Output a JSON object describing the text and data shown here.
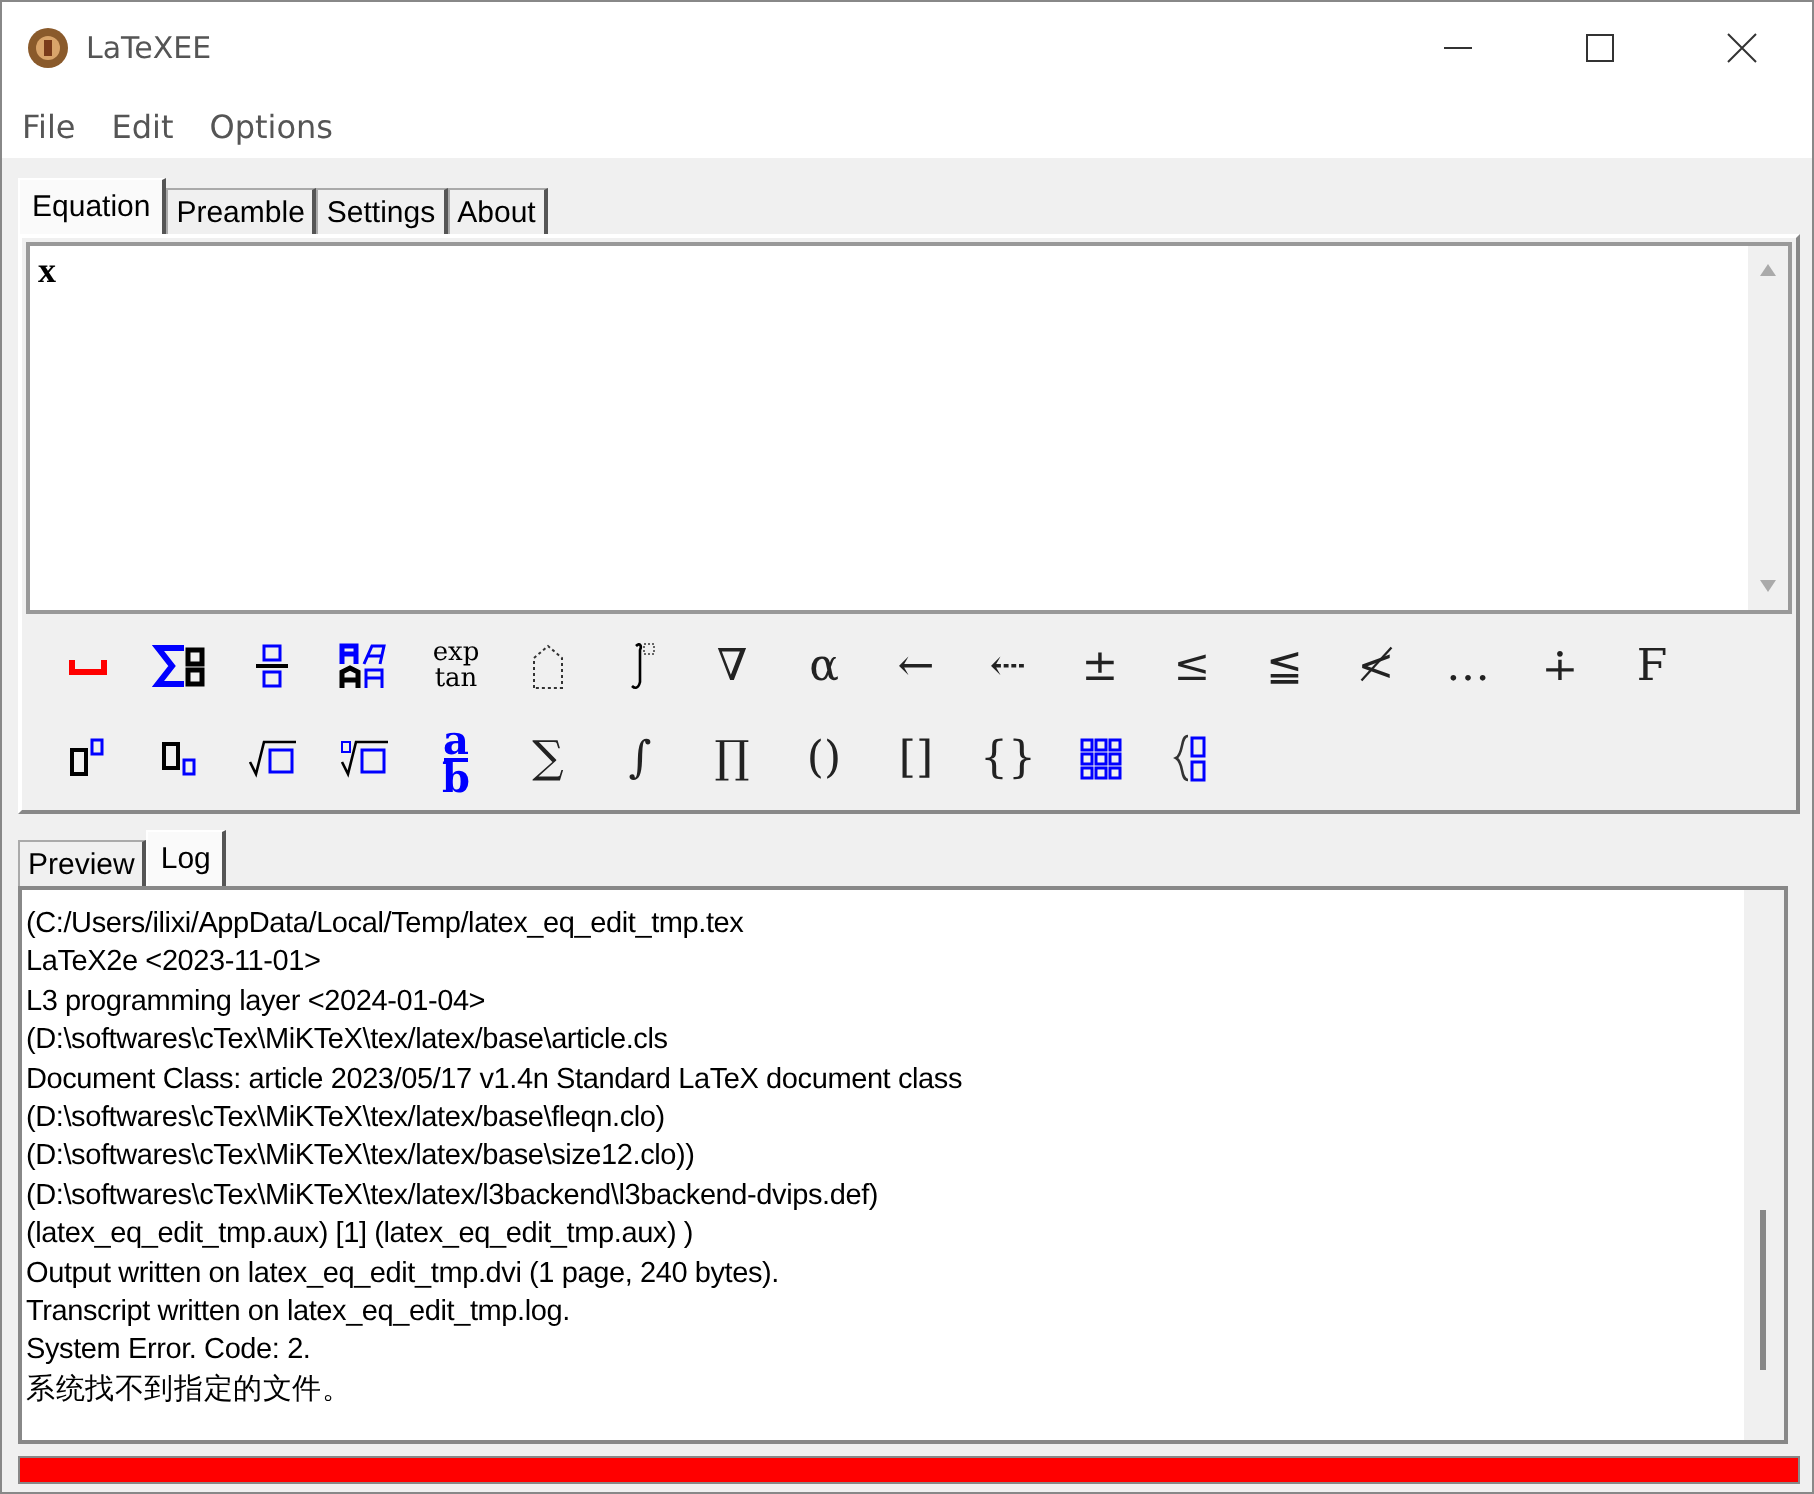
{
  "window": {
    "title": "LaTeXEE"
  },
  "menu": [
    "File",
    "Edit",
    "Options"
  ],
  "tabs": [
    {
      "label": "Equation",
      "selected": true
    },
    {
      "label": "Preamble",
      "selected": false
    },
    {
      "label": "Settings",
      "selected": false
    },
    {
      "label": "About",
      "selected": false
    }
  ],
  "equation": {
    "value": "x"
  },
  "toolbar_rows": [
    [
      {
        "kind": "space"
      },
      {
        "kind": "sum-boxes"
      },
      {
        "kind": "fraction-boxes"
      },
      {
        "kind": "font-styles"
      },
      {
        "kind": "functions",
        "lines": [
          "exp",
          "tan"
        ]
      },
      {
        "kind": "dotted-box"
      },
      {
        "kind": "integral-boxes"
      },
      {
        "kind": "glyph",
        "symbol": "∇"
      },
      {
        "kind": "glyph",
        "symbol": "α"
      },
      {
        "kind": "glyph",
        "symbol": "←"
      },
      {
        "kind": "glyph",
        "symbol": "⇠"
      },
      {
        "kind": "glyph",
        "symbol": "±"
      },
      {
        "kind": "glyph",
        "symbol": "≤"
      },
      {
        "kind": "glyph",
        "symbol": "≦"
      },
      {
        "kind": "glyph",
        "symbol": "≮"
      },
      {
        "kind": "glyph",
        "symbol": "…"
      },
      {
        "kind": "glyph",
        "symbol": "∔"
      },
      {
        "kind": "glyph",
        "symbol": "Ϝ"
      }
    ],
    [
      {
        "kind": "superscript"
      },
      {
        "kind": "subscript"
      },
      {
        "kind": "sqrt"
      },
      {
        "kind": "nth-root"
      },
      {
        "kind": "fraction-ab",
        "lines": [
          "a",
          "b"
        ]
      },
      {
        "kind": "glyph",
        "symbol": "∑"
      },
      {
        "kind": "glyph",
        "symbol": "∫"
      },
      {
        "kind": "glyph",
        "symbol": "∏"
      },
      {
        "kind": "glyph",
        "symbol": "()"
      },
      {
        "kind": "glyph",
        "symbol": "[]"
      },
      {
        "kind": "glyph",
        "symbol": "{}"
      },
      {
        "kind": "matrix"
      },
      {
        "kind": "cases"
      }
    ]
  ],
  "output_tabs": [
    {
      "label": "Preview",
      "selected": false
    },
    {
      "label": "Log",
      "selected": true
    }
  ],
  "log": [
    "(C:/Users/ilixi/AppData/Local/Temp/latex_eq_edit_tmp.tex",
    "LaTeX2e <2023-11-01>",
    "L3 programming layer <2024-01-04>",
    "(D:\\softwares\\cTex\\MiKTeX\\tex/latex/base\\article.cls",
    "Document Class: article 2023/05/17 v1.4n Standard LaTeX document class",
    "(D:\\softwares\\cTex\\MiKTeX\\tex/latex/base\\fleqn.clo)",
    "(D:\\softwares\\cTex\\MiKTeX\\tex/latex/base\\size12.clo))",
    "(D:\\softwares\\cTex\\MiKTeX\\tex/latex/l3backend\\l3backend-dvips.def)",
    "(latex_eq_edit_tmp.aux) [1] (latex_eq_edit_tmp.aux) )",
    "Output written on latex_eq_edit_tmp.dvi (1 page, 240 bytes).",
    "Transcript written on latex_eq_edit_tmp.log.",
    "System Error.  Code: 2.",
    "系统找不到指定的文件。"
  ],
  "progress": {
    "level": 1
  }
}
